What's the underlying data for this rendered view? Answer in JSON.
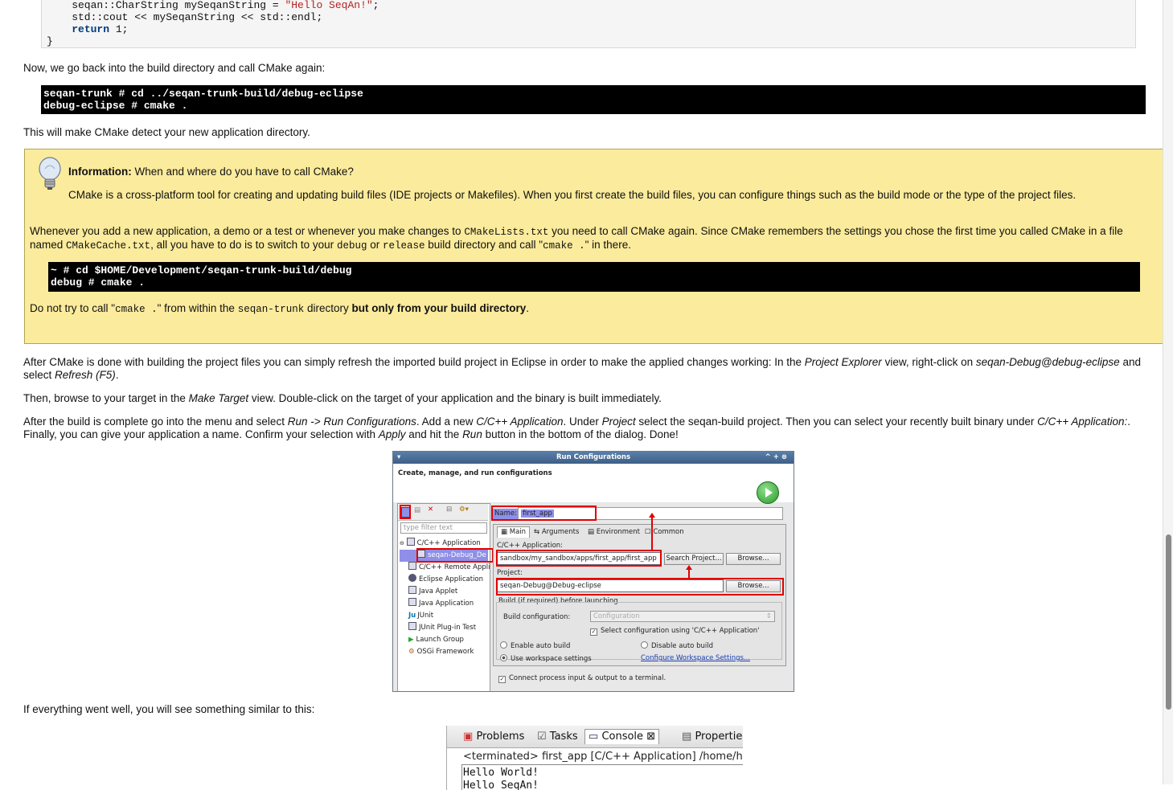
{
  "code_top": {
    "line1_a": "    seqan::CharString mySeqanString = ",
    "line1_str": "\"Hello SeqAn!\"",
    "line1_b": ";",
    "line2": "    std::cout << mySeqanString << std::endl;",
    "line3_kw": "return",
    "line3_b": " 1;",
    "line4": "}"
  },
  "p_go_back": "Now, we go back into the build directory and call CMake again:",
  "term1": {
    "line1": "seqan-trunk # cd ../seqan-trunk-build/debug-eclipse",
    "line2": "debug-eclipse # cmake ."
  },
  "p_detect": "This will make CMake detect your new application directory.",
  "info": {
    "title": "Information:",
    "title_rest": " When and where do you have to call CMake?",
    "p1": "CMake is a cross-platform tool for creating and updating build files (IDE projects or Makefiles). When you first create the build files, you can configure things such as the build mode or the type of the project files.",
    "p2_a": "Whenever you add a new application, a demo or a test or whenever you make changes to ",
    "p2_code1": "CMakeLists.txt",
    "p2_b": " you need to call CMake again. Since CMake remembers the settings you chose the first time you called CMake in a file named ",
    "p2_code2": "CMakeCache.txt",
    "p2_c": ", all you have to do is to switch to your ",
    "p2_code3": "debug",
    "p2_d": " or ",
    "p2_code4": "release",
    "p2_e": " build directory and call \"",
    "p2_code5": "cmake .",
    "p2_f": "\" in there.",
    "term_line1": "~ # cd $HOME/Development/seqan-trunk-build/debug",
    "term_line2": "debug # cmake .",
    "p3_a": "Do not try to call \"",
    "p3_code1": "cmake .",
    "p3_b": "\" from within the ",
    "p3_code2": "seqan-trunk",
    "p3_c": " directory ",
    "p3_bold": "but only from your build directory",
    "p3_d": "."
  },
  "p_after": {
    "a": "After CMake is done with building the project files you can simply refresh the imported build project in Eclipse in order to make the applied changes working: In the ",
    "em1": "Project Explorer",
    "b": " view, right-click on ",
    "em2": "seqan-Debug@debug-eclipse",
    "c": " and select ",
    "em3": "Refresh (F5)",
    "d": "."
  },
  "p_browse": {
    "a": "Then, browse to your target in the ",
    "em1": "Make Target",
    "b": " view. Double-click on the target of your application and the binary is built immediately."
  },
  "p_build": {
    "a": "After the build is complete go into the menu and select ",
    "em1": "Run -> Run Configurations",
    "b": ". Add a new ",
    "em2": "C/C++ Application",
    "c": ". Under ",
    "em3": "Project",
    "d": " select the seqan-build project. Then you can select your recently built binary under ",
    "em4": "C/C++ Application:",
    "e": ". Finally, you can give your application a name. Confirm your selection with ",
    "em5": "Apply",
    "f": " and hit the ",
    "em6": "Run",
    "g": " button in the bottom of the dialog. Done!"
  },
  "dialog": {
    "title": "Run Configurations",
    "header": "Create, manage, and run configurations",
    "filter_placeholder": "type filter text",
    "tree": [
      "C/C++ Application",
      "seqan-Debug_De",
      "C/C++ Remote Appli",
      "Eclipse Application",
      "Java Applet",
      "Java Application",
      "JUnit",
      "JUnit Plug-in Test",
      "Launch Group",
      "OSGi Framework"
    ],
    "name_label": "Name:",
    "name_value": "first_app",
    "tabs": [
      "Main",
      "Arguments",
      "Environment",
      "Common"
    ],
    "app_label": "C/C++ Application:",
    "app_value": "sandbox/my_sandbox/apps/first_app/first_app",
    "search_project": "Search Project...",
    "browse": "Browse...",
    "project_label": "Project:",
    "project_value": "seqan-Debug@Debug-eclipse",
    "browse2": "Browse...",
    "build_group": "Build (if required) before launching",
    "build_config_label": "Build configuration:",
    "build_config_value": "Configuration",
    "select_config": "Select configuration using 'C/C++ Application'",
    "enable_auto": "Enable auto build",
    "disable_auto": "Disable auto build",
    "use_workspace": "Use workspace settings",
    "configure_ws": "Configure Workspace Settings...",
    "connect": "Connect process input & output to a terminal."
  },
  "p_well": "If everything went well, you will see something similar to this:",
  "console": {
    "tabs": [
      "Problems",
      "Tasks",
      "Console",
      "Properties"
    ],
    "terminated": "<terminated> first_app [C/C++ Application] /home/h",
    "output1": "Hello World!",
    "output2": "Hello SeqAn!"
  }
}
